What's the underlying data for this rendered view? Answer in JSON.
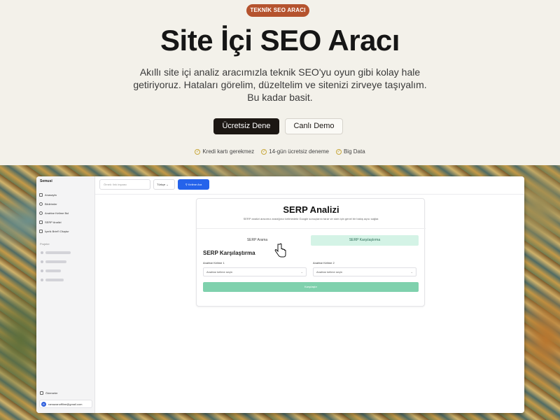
{
  "hero": {
    "badge": "TEKNİK SEO ARACI",
    "title": "Site İçi SEO Aracı",
    "description": "Akıllı site içi analiz aracımızla teknik SEO'yu oyun gibi kolay hale getiriyoruz. Hataları görelim, düzeltelim ve sitenizi zirveye taşıyalım. Bu kadar basit.",
    "primary_button": "Ücretsiz Dene",
    "secondary_button": "Canlı Demo",
    "features": [
      "Kredi kartı gerekmez",
      "14-gün ücretsiz deneme",
      "Big Data"
    ]
  },
  "app": {
    "brand": "Semusi",
    "nav": [
      {
        "label": "Anasayfa",
        "icon": "home-icon"
      },
      {
        "label": "Bildirimler",
        "icon": "bell-icon"
      },
      {
        "label": "Anahtar Kelime Bul",
        "icon": "search-icon"
      },
      {
        "label": "SERP Analizi",
        "icon": "chart-icon"
      },
      {
        "label": "İçerik Brief'i Oluştur",
        "icon": "document-icon"
      }
    ],
    "projects_label": "Projeler",
    "bottom_item": "Ödemeler",
    "user_email": "ramazanoffline@gmail.com",
    "user_initial": "R",
    "search_placeholder": "Örnek: link inşaası",
    "language": "Türkçe",
    "search_button": "Kelime Ara",
    "card": {
      "title": "SERP Analizi",
      "subtitle": "SERP analizi aracımız aradığınız kelimedeki Google sonuçlarını tarar ve sizin için genel bir bakış açısı sağlar.",
      "tab_search": "SERP Arama",
      "tab_compare": "SERP Karşılaştırma",
      "section_title": "SERP Karşılaştırma",
      "keyword1_label": "Anahtar Kelime 1",
      "keyword2_label": "Anahtar Kelime 2",
      "select_placeholder": "Anahtar kelime seçin",
      "compare_button": "Karşılaştır"
    }
  },
  "colors": {
    "badge": "#b5532e",
    "primary_button": "#1c1713",
    "accent_blue": "#2563eb",
    "accent_green": "#7fd1ad"
  }
}
